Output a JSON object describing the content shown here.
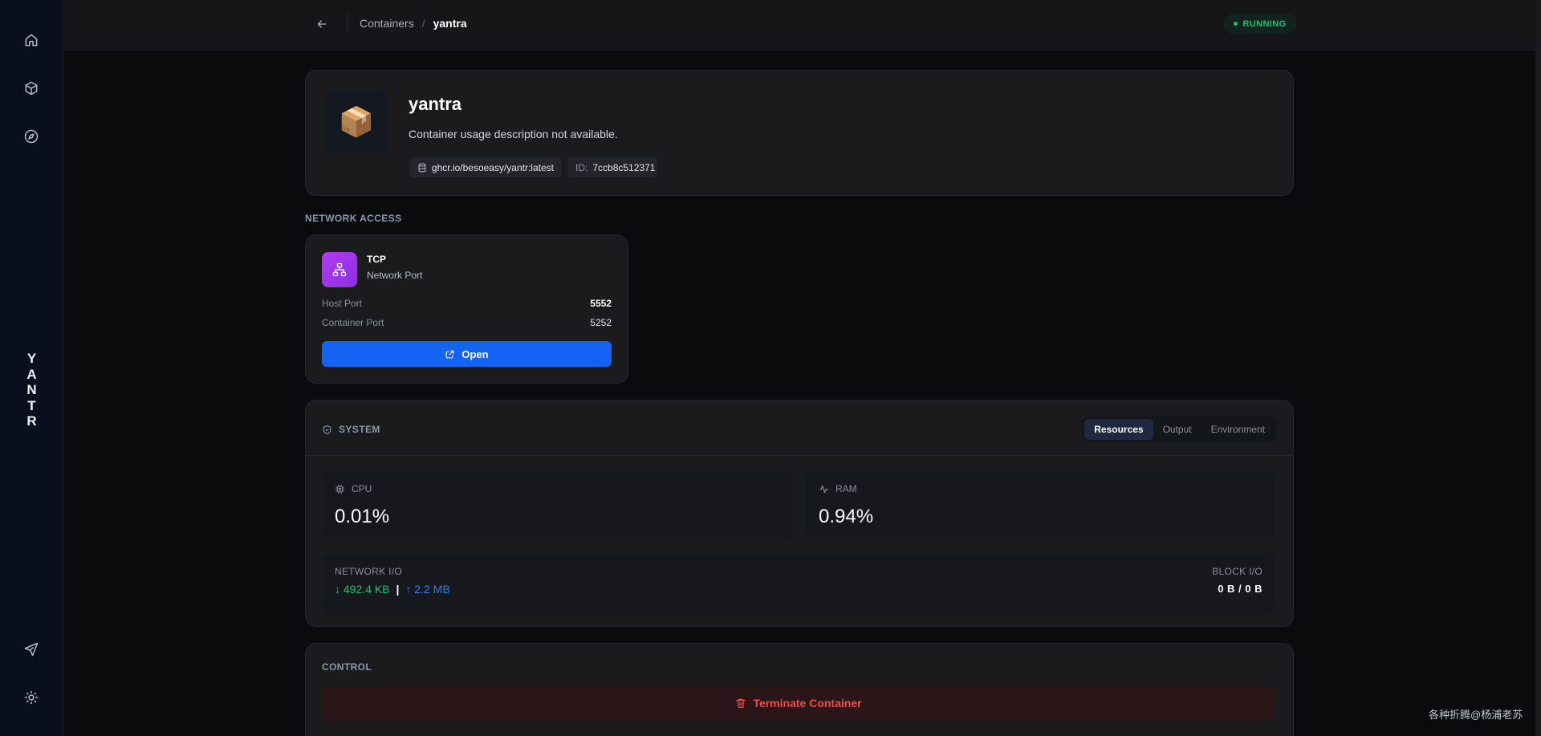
{
  "sidebar": {
    "icons": [
      "home-icon",
      "box-icon",
      "compass-icon",
      "send-icon",
      "sun-icon"
    ],
    "brand_letters": [
      "Y",
      "A",
      "N",
      "T",
      "R"
    ]
  },
  "header": {
    "breadcrumb_parent": "Containers",
    "breadcrumb_separator": "/",
    "breadcrumb_current": "yantra",
    "status": "RUNNING"
  },
  "container": {
    "name": "yantra",
    "icon": "📦",
    "description": "Container usage description not available.",
    "image": "ghcr.io/besoeasy/yantr:latest",
    "id_label": "ID:",
    "id": "7ccb8c512371"
  },
  "network": {
    "section_title": "NETWORK ACCESS",
    "protocol": "TCP",
    "subtitle": "Network Port",
    "host_port_label": "Host Port",
    "host_port": "5552",
    "container_port_label": "Container Port",
    "container_port": "5252",
    "open_label": "Open"
  },
  "system": {
    "title": "SYSTEM",
    "tabs": [
      "Resources",
      "Output",
      "Environment"
    ],
    "active_tab": "Resources",
    "cpu_label": "CPU",
    "cpu_value": "0.01%",
    "ram_label": "RAM",
    "ram_value": "0.94%",
    "network_io_label": "NETWORK I/O",
    "network_down": "↓ 492.4 KB",
    "network_sep": "|",
    "network_up": "↑ 2.2 MB",
    "block_io_label": "BLOCK I/O",
    "block_io_value": "0 B / 0 B"
  },
  "control": {
    "title": "CONTROL",
    "terminate_label": "Terminate Container"
  },
  "watermark": "各种折腾@杨浦老苏",
  "colors": {
    "accent": "#1463f3",
    "running": "#1fbf73",
    "danger": "#f04a4a",
    "upload": "#2f7cf6"
  }
}
